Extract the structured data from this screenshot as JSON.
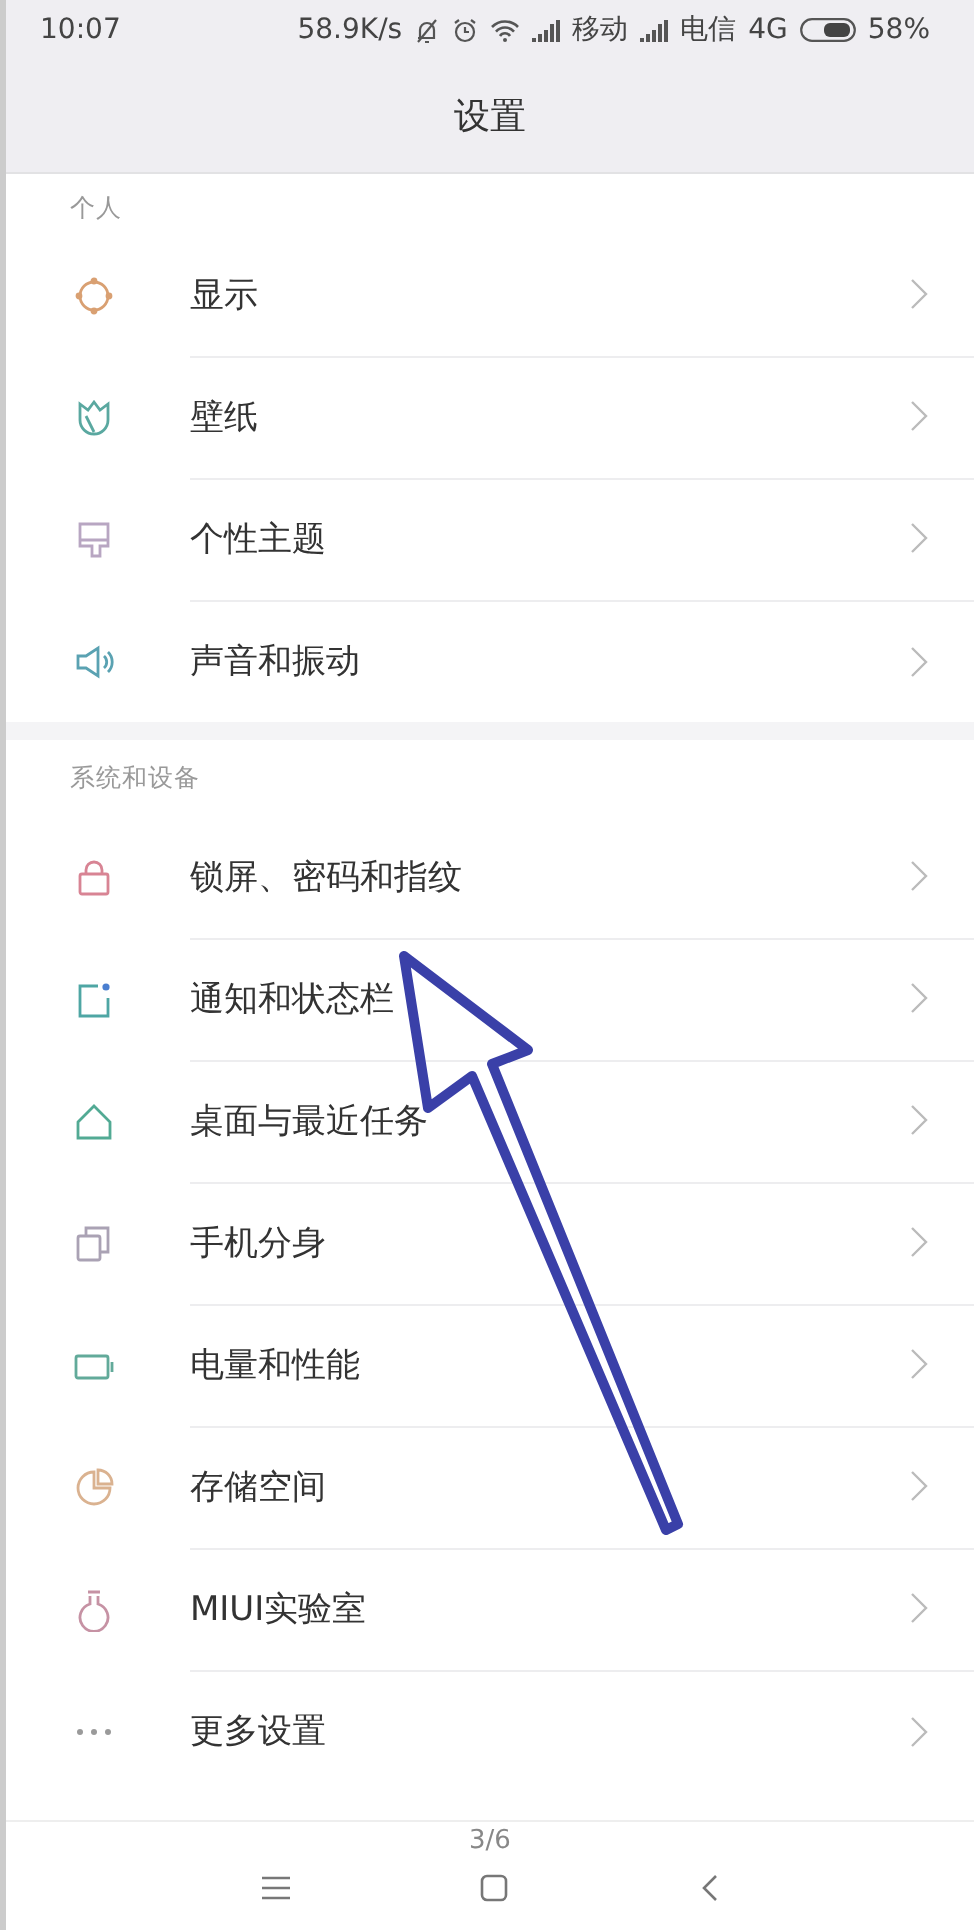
{
  "status_bar": {
    "time": "10:07",
    "speed": "58.9K/s",
    "carrier_1": "移动",
    "carrier_2": "电信",
    "network": "4G",
    "battery": "58%"
  },
  "title": "设置",
  "sections": [
    {
      "header": "个人",
      "items": [
        {
          "label": "显示",
          "kind": "sun",
          "color": "#d9a072"
        },
        {
          "label": "壁纸",
          "kind": "tulip",
          "color": "#5aa8a0"
        },
        {
          "label": "个性主题",
          "kind": "brush",
          "color": "#b8a6c2"
        },
        {
          "label": "声音和振动",
          "kind": "speaker",
          "color": "#5aa2b2"
        }
      ]
    },
    {
      "header": "系统和设备",
      "items": [
        {
          "label": "锁屏、密码和指纹",
          "kind": "lock",
          "color": "#d88494"
        },
        {
          "label": "通知和状态栏",
          "kind": "notice",
          "color": "#4ea6a4"
        },
        {
          "label": "桌面与最近任务",
          "kind": "home",
          "color": "#52aa94"
        },
        {
          "label": "手机分身",
          "kind": "copies",
          "color": "#aaa2b4"
        },
        {
          "label": "电量和性能",
          "kind": "battery",
          "color": "#62aa9a"
        },
        {
          "label": "存储空间",
          "kind": "pie",
          "color": "#dab290"
        },
        {
          "label": "MIUI实验室",
          "kind": "flask",
          "color": "#c692a4"
        },
        {
          "label": "更多设置",
          "kind": "dots",
          "color": "#9a9a9a"
        }
      ]
    }
  ],
  "nav_bar": {
    "page": "3/6"
  }
}
